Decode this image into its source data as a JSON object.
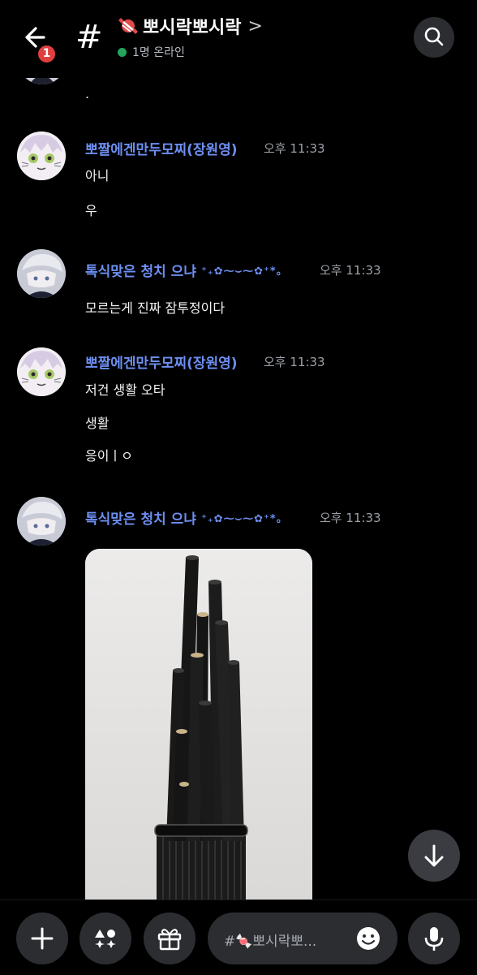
{
  "header": {
    "unread_badge": "1",
    "hash": "#",
    "channel_name": "뽀시락뽀시락",
    "chevron": ">",
    "online_text": "1명 온라인"
  },
  "colors": {
    "background": "#000000",
    "author_name": "#6d8ff2",
    "timestamp": "#9da1a8",
    "online_dot": "#23a55a",
    "badge": "#e03f3f",
    "button_bg": "#2b2d31"
  },
  "messages": {
    "top_fragment": ".",
    "g1": {
      "author": "뽀짤에겐만두모찌(장원영)",
      "time": "오후 11:33",
      "lines": [
        "아니",
        "우"
      ]
    },
    "g2": {
      "author": "톡식맞은 청치 으냐",
      "decoration": "⁺₊✿⁓⌣⁓✿⁺*。",
      "time": "오후 11:33",
      "lines": [
        "모르는게 진짜 잠투정이다"
      ]
    },
    "g3": {
      "author": "뽀짤에겐만두모찌(장원영)",
      "time": "오후 11:33",
      "lines": [
        "저건 생활 오타",
        "생활",
        "응이ㅣㅇ"
      ]
    },
    "g4": {
      "author": "톡식맞은 청치 으냐",
      "decoration": "⁺₊✿⁓⌣⁓✿⁺*。",
      "time": "오후 11:33"
    }
  },
  "composer": {
    "placeholder": "#🍬뽀시락뽀..."
  },
  "icons": {
    "back": "arrow-left-icon",
    "search": "search-icon",
    "add": "plus-icon",
    "apps": "apps-icon",
    "gift": "gift-icon",
    "emoji": "emoji-icon",
    "mic": "microphone-icon",
    "scroll": "arrow-down-icon"
  }
}
